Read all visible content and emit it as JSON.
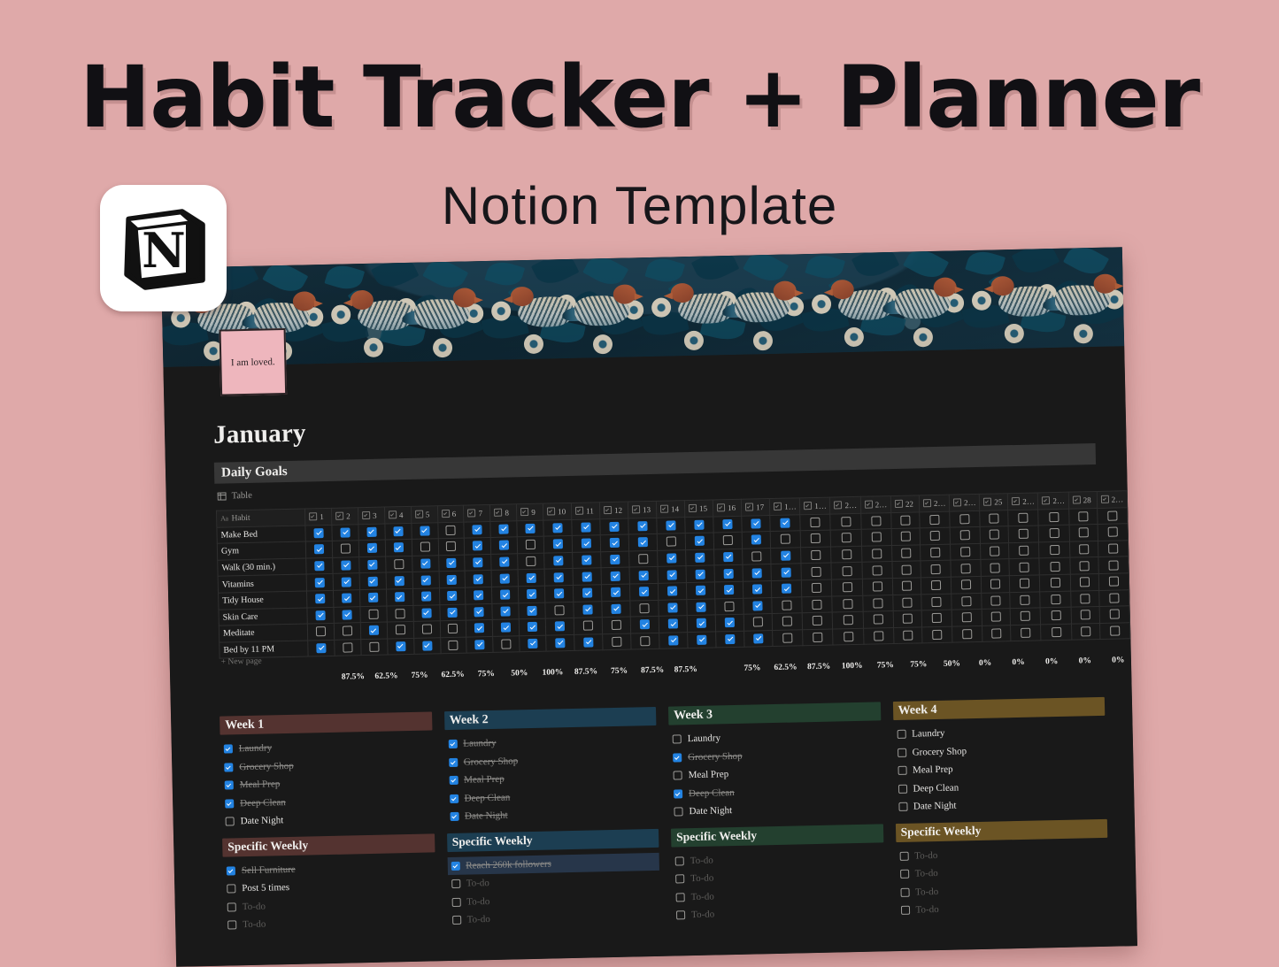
{
  "hero": {
    "title": "Habit Tracker + Planner",
    "subtitle": "Notion Template",
    "logo_icon": "notion-logo-icon",
    "background_color": "#dfa9a9"
  },
  "notion_page": {
    "cover_caption": "I am loved.",
    "page_title": "January",
    "callout_title": "Daily Goals",
    "table_view_label": "Table",
    "table_view_icon": "table-icon",
    "new_page_label": "New page",
    "new_page_icon": "plus-icon",
    "habit_column_header": "Habit",
    "habit_column_type_icon": "text-type-icon",
    "day_columns": [
      "1",
      "2",
      "3",
      "4",
      "5",
      "6",
      "7",
      "8",
      "9",
      "10",
      "11",
      "12",
      "13",
      "14",
      "15",
      "16",
      "17",
      "1…",
      "1…",
      "2…",
      "2…",
      "22",
      "2…",
      "2…",
      "25",
      "2…",
      "2…",
      "28",
      "2…"
    ],
    "accent_checked_color": "#2383e2",
    "rows": [
      {
        "habit": "Make Bed",
        "values": [
          1,
          1,
          1,
          1,
          1,
          0,
          1,
          1,
          1,
          1,
          1,
          1,
          1,
          1,
          1,
          1,
          1,
          1,
          0,
          0,
          0,
          0,
          0,
          0,
          0,
          0,
          0,
          0,
          0
        ]
      },
      {
        "habit": "Gym",
        "values": [
          1,
          0,
          1,
          1,
          0,
          0,
          1,
          1,
          0,
          1,
          1,
          1,
          1,
          0,
          1,
          0,
          1,
          0,
          0,
          0,
          0,
          0,
          0,
          0,
          0,
          0,
          0,
          0,
          0
        ]
      },
      {
        "habit": "Walk (30 min.)",
        "values": [
          1,
          1,
          1,
          0,
          1,
          1,
          1,
          1,
          0,
          1,
          1,
          1,
          0,
          1,
          1,
          1,
          0,
          1,
          0,
          0,
          0,
          0,
          0,
          0,
          0,
          0,
          0,
          0,
          0
        ]
      },
      {
        "habit": "Vitamins",
        "values": [
          1,
          1,
          1,
          1,
          1,
          1,
          1,
          1,
          1,
          1,
          1,
          1,
          1,
          1,
          1,
          1,
          1,
          1,
          0,
          0,
          0,
          0,
          0,
          0,
          0,
          0,
          0,
          0,
          0
        ]
      },
      {
        "habit": "Tidy House",
        "values": [
          1,
          1,
          1,
          1,
          1,
          1,
          1,
          1,
          1,
          1,
          1,
          1,
          1,
          1,
          1,
          1,
          1,
          1,
          0,
          0,
          0,
          0,
          0,
          0,
          0,
          0,
          0,
          0,
          0
        ]
      },
      {
        "habit": "Skin Care",
        "values": [
          1,
          1,
          0,
          0,
          1,
          1,
          1,
          1,
          1,
          0,
          1,
          1,
          0,
          1,
          1,
          0,
          1,
          0,
          0,
          0,
          0,
          0,
          0,
          0,
          0,
          0,
          0,
          0,
          0
        ]
      },
      {
        "habit": "Meditate",
        "values": [
          0,
          0,
          1,
          0,
          0,
          0,
          1,
          1,
          1,
          1,
          0,
          0,
          1,
          1,
          1,
          1,
          0,
          0,
          0,
          0,
          0,
          0,
          0,
          0,
          0,
          0,
          0,
          0,
          0
        ]
      },
      {
        "habit": "Bed by 11 PM",
        "values": [
          1,
          0,
          0,
          1,
          1,
          0,
          1,
          0,
          1,
          1,
          1,
          0,
          0,
          1,
          1,
          1,
          1,
          0,
          0,
          0,
          0,
          0,
          0,
          0,
          0,
          0,
          0,
          0,
          0
        ]
      }
    ],
    "percentages": [
      "87.5%",
      "62.5%",
      "75%",
      "62.5%",
      "75%",
      "50%",
      "100%",
      "87.5%",
      "75%",
      "87.5%",
      "87.5%",
      "",
      "75%",
      "62.5%",
      "87.5%",
      "100%",
      "75%",
      "75%",
      "50%",
      "0%",
      "0%",
      "0%",
      "0%",
      "0%",
      "0%",
      "0%",
      "0%",
      "0%",
      "0%"
    ],
    "weeks": [
      {
        "label": "Week 1",
        "color": "#543330",
        "items": [
          {
            "text": "Laundry",
            "checked": true
          },
          {
            "text": "Grocery Shop",
            "checked": true
          },
          {
            "text": "Meal Prep",
            "checked": true
          },
          {
            "text": "Deep Clean",
            "checked": true
          },
          {
            "text": "Date Night",
            "checked": false
          }
        ],
        "specific_label": "Specific Weekly",
        "specific": [
          {
            "text": "Sell Furniture",
            "checked": true,
            "ghost": false
          },
          {
            "text": "Post 5 times",
            "checked": false,
            "ghost": false
          },
          {
            "text": "To-do",
            "checked": false,
            "ghost": true
          },
          {
            "text": "To-do",
            "checked": false,
            "ghost": true
          }
        ]
      },
      {
        "label": "Week 2",
        "color": "#1c3e52",
        "items": [
          {
            "text": "Laundry",
            "checked": true
          },
          {
            "text": "Grocery Shop",
            "checked": true
          },
          {
            "text": "Meal Prep",
            "checked": true
          },
          {
            "text": "Deep Clean",
            "checked": true
          },
          {
            "text": "Date Night",
            "checked": true
          }
        ],
        "specific_label": "Specific Weekly",
        "specific": [
          {
            "text": "Reach 260k followers",
            "checked": true,
            "ghost": false
          },
          {
            "text": "To-do",
            "checked": false,
            "ghost": true
          },
          {
            "text": "To-do",
            "checked": false,
            "ghost": true
          },
          {
            "text": "To-do",
            "checked": false,
            "ghost": true
          }
        ]
      },
      {
        "label": "Week 3",
        "color": "#23402f",
        "items": [
          {
            "text": "Laundry",
            "checked": false
          },
          {
            "text": "Grocery Shop",
            "checked": true
          },
          {
            "text": "Meal Prep",
            "checked": false
          },
          {
            "text": "Deep Clean",
            "checked": true
          },
          {
            "text": "Date Night",
            "checked": false
          }
        ],
        "specific_label": "Specific Weekly",
        "specific": [
          {
            "text": "To-do",
            "checked": false,
            "ghost": true
          },
          {
            "text": "To-do",
            "checked": false,
            "ghost": true
          },
          {
            "text": "To-do",
            "checked": false,
            "ghost": true
          },
          {
            "text": "To-do",
            "checked": false,
            "ghost": true
          }
        ]
      },
      {
        "label": "Week 4",
        "color": "#6b5424",
        "items": [
          {
            "text": "Laundry",
            "checked": false
          },
          {
            "text": "Grocery Shop",
            "checked": false
          },
          {
            "text": "Meal Prep",
            "checked": false
          },
          {
            "text": "Deep Clean",
            "checked": false
          },
          {
            "text": "Date Night",
            "checked": false
          }
        ],
        "specific_label": "Specific Weekly",
        "specific": [
          {
            "text": "To-do",
            "checked": false,
            "ghost": true
          },
          {
            "text": "To-do",
            "checked": false,
            "ghost": true
          },
          {
            "text": "To-do",
            "checked": false,
            "ghost": true
          },
          {
            "text": "To-do",
            "checked": false,
            "ghost": true
          }
        ]
      }
    ]
  }
}
